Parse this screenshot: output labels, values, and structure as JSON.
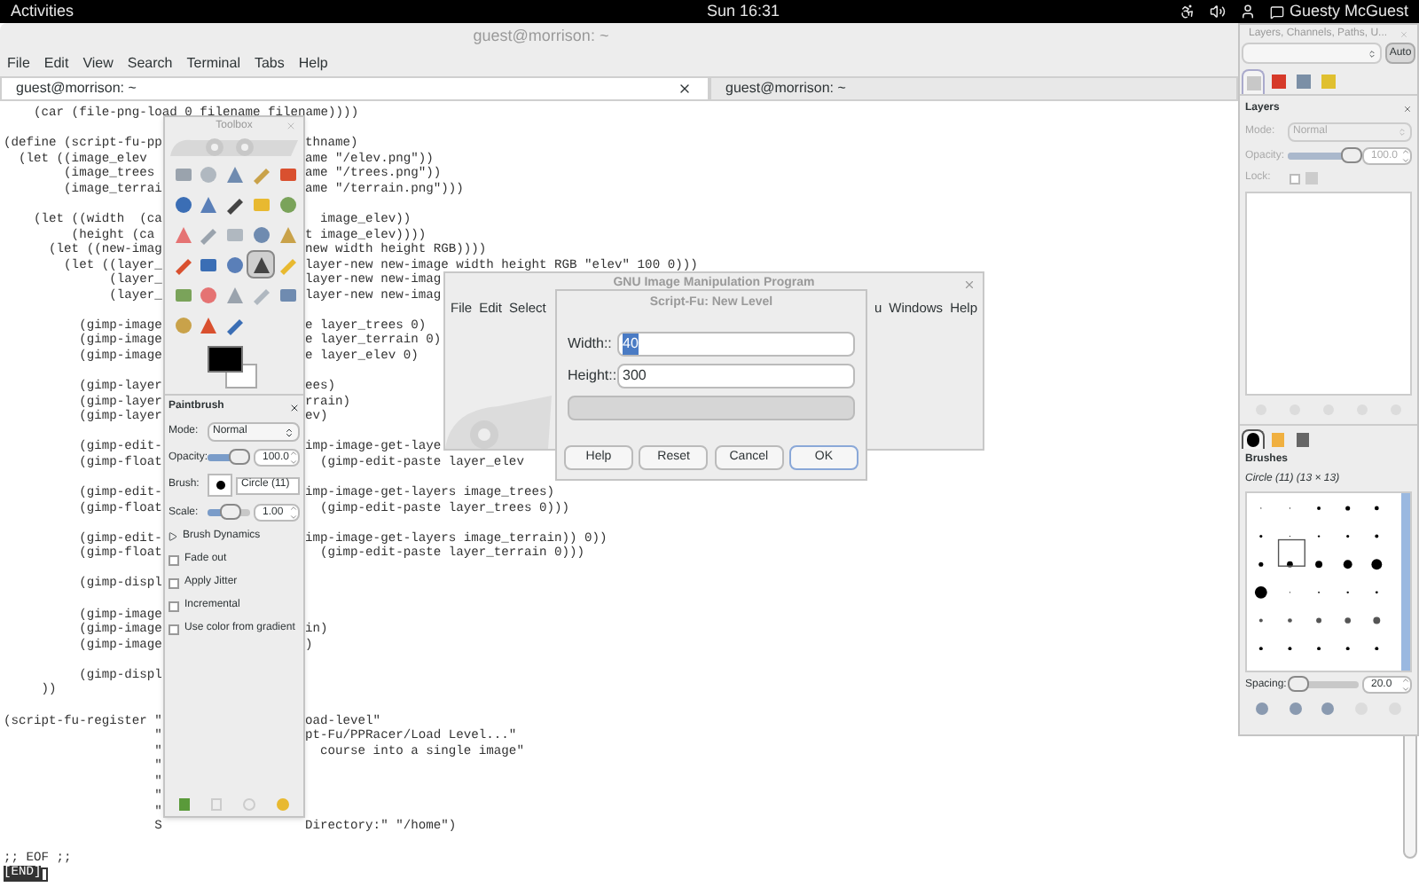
{
  "top_bar": {
    "activities": "Activities",
    "clock": "Sun 16:31",
    "user": "Guesty McGuest"
  },
  "terminal": {
    "title": "guest@morrison: ~",
    "menu": [
      "File",
      "Edit",
      "View",
      "Search",
      "Terminal",
      "Tabs",
      "Help"
    ],
    "tabs": [
      {
        "label": "guest@morrison: ~",
        "selected": true
      },
      {
        "label": "guest@morrison: ~",
        "selected": false
      }
    ],
    "lines": [
      {
        "kind": "code",
        "left": "    (car (file-png-load 0 filename filename))))"
      },
      {
        "kind": "blank"
      },
      {
        "kind": "code",
        "left": "(define (script-fu-pp",
        "right": "thname)"
      },
      {
        "kind": "code",
        "left": "  (let ((image_elev",
        "right": "ame \"/elev.png\"))"
      },
      {
        "kind": "code",
        "left": "        (image_trees",
        "right": "ame \"/trees.png\"))"
      },
      {
        "kind": "code",
        "left": "        (image_terrai",
        "right": "ame \"/terrain.png\")))"
      },
      {
        "kind": "blank"
      },
      {
        "kind": "code",
        "left": "    (let ((width  (ca",
        "right": "  image_elev))"
      },
      {
        "kind": "code",
        "left": "         (height (ca",
        "right": "t image_elev))))"
      },
      {
        "kind": "code",
        "left": "      (let ((new-imag",
        "right": "new width height RGB))))"
      },
      {
        "kind": "code",
        "left": "        (let ((layer_",
        "right": "layer-new new-image width height RGB \"elev\" 100 0)))"
      },
      {
        "kind": "code",
        "left": "              (layer_",
        "right": "layer-new new-imag"
      },
      {
        "kind": "code",
        "left": "              (layer_",
        "right": "layer-new new-imag"
      },
      {
        "kind": "blank"
      },
      {
        "kind": "code",
        "left": "          (gimp-image",
        "right": "e layer_trees 0)"
      },
      {
        "kind": "code",
        "left": "          (gimp-image",
        "right": "e layer_terrain 0)"
      },
      {
        "kind": "code",
        "left": "          (gimp-image",
        "right": "e layer_elev 0)"
      },
      {
        "kind": "blank"
      },
      {
        "kind": "code",
        "left": "          (gimp-layer",
        "right": "ees)"
      },
      {
        "kind": "code",
        "left": "          (gimp-layer",
        "right": "rrain)"
      },
      {
        "kind": "code",
        "left": "          (gimp-layer",
        "right": "ev)"
      },
      {
        "kind": "blank"
      },
      {
        "kind": "code",
        "left": "          (gimp-edit-",
        "right": "imp-image-get-laye"
      },
      {
        "kind": "code",
        "left": "          (gimp-float",
        "right": "  (gimp-edit-paste layer_elev"
      },
      {
        "kind": "blank"
      },
      {
        "kind": "code",
        "left": "          (gimp-edit-",
        "right": "imp-image-get-layers image_trees)"
      },
      {
        "kind": "code",
        "left": "          (gimp-float",
        "right": "  (gimp-edit-paste layer_trees 0)))"
      },
      {
        "kind": "blank"
      },
      {
        "kind": "code",
        "left": "          (gimp-edit-",
        "right": "imp-image-get-layers image_terrain)) 0))"
      },
      {
        "kind": "code",
        "left": "          (gimp-float",
        "right": "  (gimp-edit-paste layer_terrain 0)))"
      },
      {
        "kind": "blank"
      },
      {
        "kind": "code",
        "left": "          (gimp-displ"
      },
      {
        "kind": "blank"
      },
      {
        "kind": "code",
        "left": "          (gimp-image"
      },
      {
        "kind": "code",
        "left": "          (gimp-image",
        "right": "in)"
      },
      {
        "kind": "code",
        "left": "          (gimp-image",
        "right": ")"
      },
      {
        "kind": "blank"
      },
      {
        "kind": "code",
        "left": "          (gimp-displ"
      },
      {
        "kind": "code",
        "left": "     ))"
      },
      {
        "kind": "blank"
      },
      {
        "kind": "code",
        "left": "(script-fu-register \"",
        "right": "oad-level\""
      },
      {
        "kind": "code",
        "left": "                    \"",
        "right": "pt-Fu/PPRacer/Load Level...\""
      },
      {
        "kind": "code",
        "left": "                    \"",
        "right": "  course into a single image\""
      },
      {
        "kind": "code",
        "left": "                    \""
      },
      {
        "kind": "code",
        "left": "                    \""
      },
      {
        "kind": "code",
        "left": "                    \""
      },
      {
        "kind": "code",
        "left": "                    \""
      },
      {
        "kind": "code",
        "left": "                    S",
        "right": "Directory:\" \"/home\")"
      },
      {
        "kind": "blank"
      },
      {
        "kind": "code",
        "left": ";; EOF ;;"
      }
    ],
    "prompt": "[END]"
  },
  "toolbox": {
    "title": "Toolbox",
    "tools": [
      {
        "selected": false
      },
      {
        "selected": false
      },
      {
        "selected": false
      },
      {
        "selected": false
      },
      {
        "selected": false
      },
      {
        "selected": false
      },
      {
        "selected": false
      },
      {
        "selected": false
      },
      {
        "selected": false
      },
      {
        "selected": false
      },
      {
        "selected": false
      },
      {
        "selected": false
      },
      {
        "selected": false
      },
      {
        "selected": false
      },
      {
        "selected": false
      },
      {
        "selected": false
      },
      {
        "selected": false
      },
      {
        "selected": false
      },
      {
        "selected": true
      },
      {
        "selected": false
      },
      {
        "selected": false
      },
      {
        "selected": false
      },
      {
        "selected": false
      },
      {
        "selected": false
      },
      {
        "selected": false
      },
      {
        "selected": false
      },
      {
        "selected": false
      },
      {
        "selected": false
      }
    ],
    "options": {
      "title": "Paintbrush",
      "mode_label": "Mode:",
      "mode": "Normal",
      "opacity_label": "Opacity:",
      "opacity": "100.0",
      "opacity_slider": {
        "level": 0.75
      },
      "brush_label": "Brush:",
      "brush": "Circle (11)",
      "scale_label": "Scale:",
      "scale": "1.00",
      "scale_slider": {
        "level": 0.55
      },
      "dynamics": "Brush Dynamics",
      "checks": [
        {
          "label": "Fade out",
          "checked": false
        },
        {
          "label": "Apply Jitter",
          "checked": false
        },
        {
          "label": "Incremental",
          "checked": false
        },
        {
          "label": "Use color from gradient",
          "checked": false
        }
      ]
    }
  },
  "gimp": {
    "title": "GNU Image Manipulation Program",
    "menu_left": [
      "File",
      "Edit",
      "Select"
    ],
    "menu_right": [
      "u",
      "Windows",
      "Help"
    ]
  },
  "dialog": {
    "title": "Script-Fu: New Level",
    "fields": [
      {
        "label": "Width::",
        "value": "40",
        "selected": true
      },
      {
        "label": "Height::",
        "value": "300",
        "selected": false
      }
    ],
    "buttons": [
      {
        "label": "Help",
        "default": false
      },
      {
        "label": "Reset",
        "default": false
      },
      {
        "label": "Cancel",
        "default": false
      },
      {
        "label": "OK",
        "default": true
      }
    ]
  },
  "dock": {
    "title": "Layers, Channels, Paths, U...",
    "auto": "Auto",
    "tabs": [
      {
        "selected": true
      },
      {
        "selected": false
      },
      {
        "selected": false
      },
      {
        "selected": false
      }
    ],
    "layers": {
      "title": "Layers",
      "disabled": true,
      "mode_label": "Mode:",
      "mode": "Normal",
      "opacity_label": "Opacity:",
      "opacity": "100.0",
      "level": 0.9,
      "lock_label": "Lock:",
      "lock_checked": false
    },
    "brush_tabs": [
      {
        "selected": true
      },
      {
        "selected": false
      },
      {
        "selected": false
      }
    ],
    "brushes": {
      "title": "Brushes",
      "current": "Circle (11) (13 × 13)",
      "spacing_label": "Spacing:",
      "spacing": "20.0",
      "level": 0.12
    }
  }
}
